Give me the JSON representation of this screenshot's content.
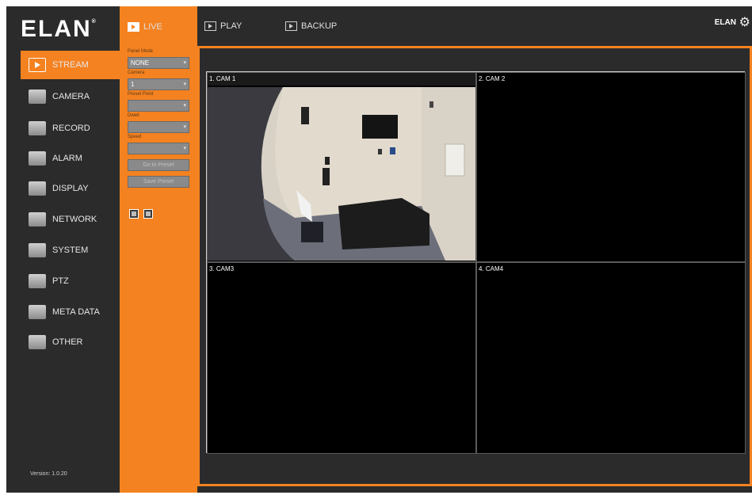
{
  "header": {
    "logo": "ELAN",
    "logo_mark": "®",
    "tabs": [
      {
        "label": "LIVE",
        "icon": "live-tab-icon"
      },
      {
        "label": "PLAY",
        "icon": "play-tab-icon"
      },
      {
        "label": "BACKUP",
        "icon": "backup-tab-icon"
      }
    ],
    "user_label": "ELAN"
  },
  "sidebar": {
    "items": [
      {
        "label": "STREAM",
        "icon": "stream-icon"
      },
      {
        "label": "CAMERA",
        "icon": "camera-icon"
      },
      {
        "label": "RECORD",
        "icon": "record-icon"
      },
      {
        "label": "ALARM",
        "icon": "alarm-icon"
      },
      {
        "label": "DISPLAY",
        "icon": "display-icon"
      },
      {
        "label": "NETWORK",
        "icon": "network-icon"
      },
      {
        "label": "SYSTEM",
        "icon": "system-icon"
      },
      {
        "label": "PTZ",
        "icon": "ptz-icon"
      },
      {
        "label": "META DATA",
        "icon": "meta-data-icon"
      },
      {
        "label": "OTHER",
        "icon": "other-icon"
      }
    ],
    "version": "Version: 1.0.20"
  },
  "controls": {
    "panel_mode_label": "Panel Mode",
    "panel_mode_value": "NONE",
    "camera_label": "Camera",
    "camera_value": "1",
    "preset_point_label": "Preset Point",
    "preset_point_value": "",
    "dwell_label": "Dwell",
    "dwell_value": "",
    "speed_label": "Speed",
    "speed_value": "",
    "goto_preset_label": "Go to Preset",
    "save_preset_label": "Save Preset"
  },
  "cameras": [
    {
      "title": "1. CAM 1"
    },
    {
      "title": "2. CAM 2"
    },
    {
      "title": "3. CAM3"
    },
    {
      "title": "4. CAM4"
    }
  ],
  "colors": {
    "accent": "#f58220",
    "background": "#2b2b2b"
  }
}
